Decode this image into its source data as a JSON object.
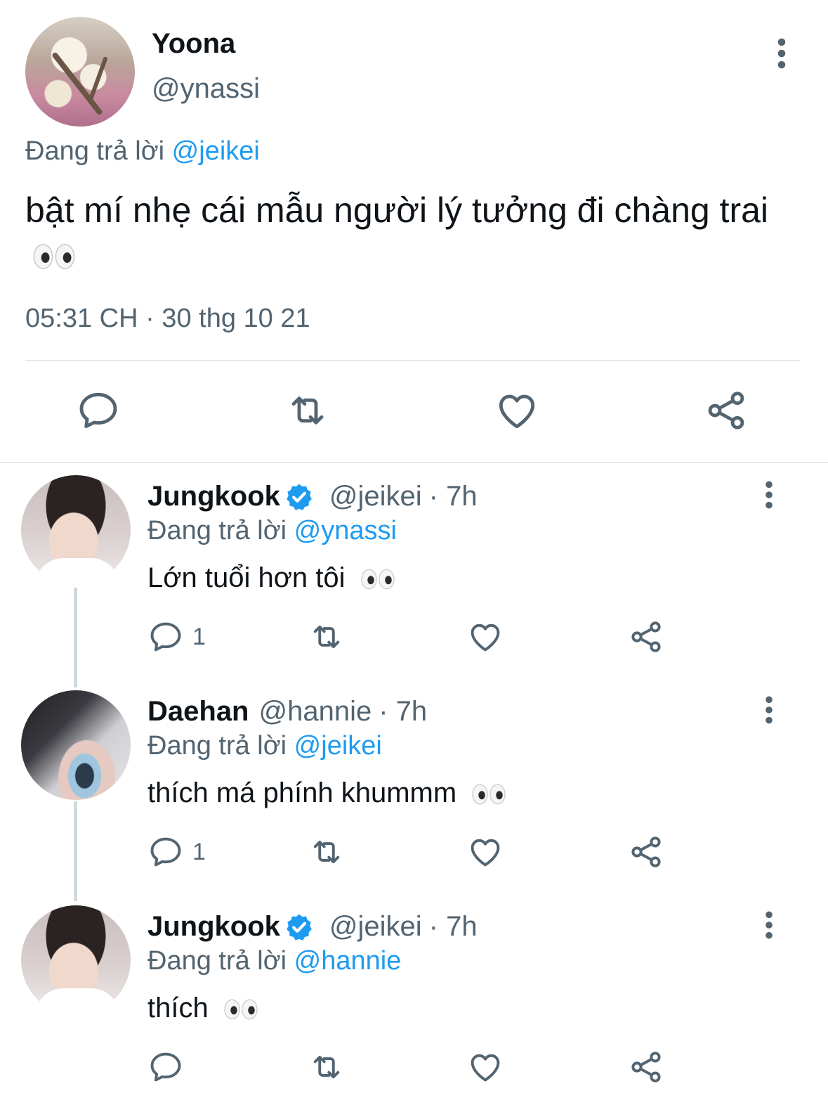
{
  "main_tweet": {
    "display_name": "Yoona",
    "handle": "@ynassi",
    "reply_prefix": "Đang trả lời",
    "reply_mention": "@jeikei",
    "text": "bật mí nhẹ cái mẫu người lý tưởng đi chàng trai",
    "emoji": "eyes",
    "timestamp": "05:31 CH · 30 thg 10 21",
    "actions": [
      "reply-icon",
      "retweet-icon",
      "like-icon",
      "share-icon"
    ]
  },
  "replies": [
    {
      "display_name": "Jungkook",
      "verified": true,
      "handle": "@jeikei",
      "time": "· 7h",
      "reply_prefix": "Đang trả lời",
      "reply_mention": "@ynassi",
      "text": "Lớn tuổi hơn tôi",
      "reply_count": "1"
    },
    {
      "display_name": "Daehan",
      "verified": false,
      "handle": "@hannie",
      "time": "· 7h",
      "reply_prefix": "Đang trả lời",
      "reply_mention": "@jeikei",
      "text": "thích má phính khummm",
      "reply_count": "1"
    },
    {
      "display_name": "Jungkook",
      "verified": true,
      "handle": "@jeikei",
      "time": "· 7h",
      "reply_prefix": "Đang trả lời",
      "reply_mention": "@hannie",
      "text": "thích",
      "reply_count": ""
    }
  ],
  "colors": {
    "accent": "#1d9bf0",
    "secondary_text": "#536471",
    "icon": "#536471",
    "divider": "#e6e9eb"
  }
}
